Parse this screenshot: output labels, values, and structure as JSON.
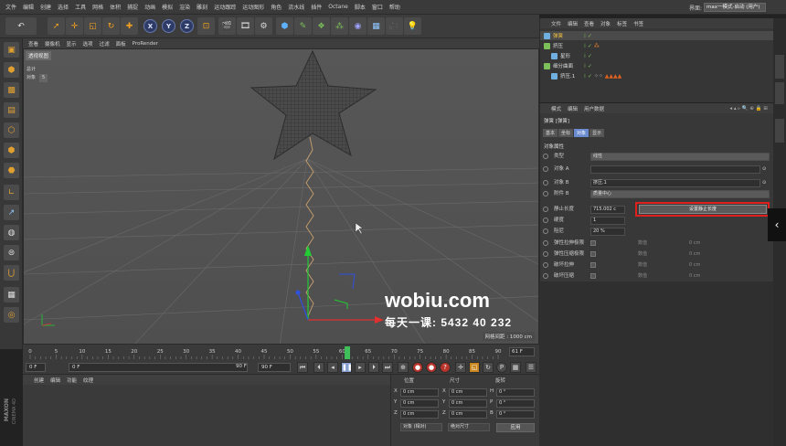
{
  "menubar": {
    "items": [
      "文件",
      "编辑",
      "创建",
      "选择",
      "工具",
      "网格",
      "体积",
      "捕捉",
      "动画",
      "模拟",
      "渲染",
      "雕刻",
      "运动跟踪",
      "运动图形",
      "角色",
      "流水线",
      "插件",
      "Octane",
      "脚本",
      "窗口",
      "帮助"
    ],
    "layout_label": "界面:",
    "layout_value": "max一模式-启动 (用户)"
  },
  "toolbar": {
    "axis_x": "X",
    "axis_y": "Y",
    "axis_z": "Z"
  },
  "viewport": {
    "menu": [
      "查看",
      "摄像机",
      "显示",
      "选项",
      "过滤",
      "面板",
      "ProRender"
    ],
    "view_label": "透视视图",
    "stats_total_label": "总计",
    "stats_objects_label": "对象",
    "stats_objects_value": "5",
    "grid_distance": "网格间距 : 1000 cm",
    "watermark_line1": "wobiu.com",
    "watermark_line2": "每天一课: 5432 40 232",
    "colors": {
      "background": "#545454",
      "grid": "#6a6a6a",
      "axis_y": "#22cc33",
      "axis_x": "#e03030",
      "axis_z": "#3050e0",
      "spring": "#c8a070"
    }
  },
  "timeline": {
    "ticks": [
      "0",
      "5",
      "10",
      "15",
      "20",
      "25",
      "30",
      "35",
      "40",
      "45",
      "50",
      "55",
      "60",
      "65",
      "70",
      "75",
      "80",
      "85",
      "90"
    ],
    "current_frame": "61",
    "end_field": "61 F"
  },
  "transport": {
    "start_field": "0 F",
    "start_field2": "0 F",
    "end_field": "90 F",
    "end_field2": "90 F"
  },
  "material": {
    "menu": [
      "创建",
      "编辑",
      "功能",
      "纹理"
    ]
  },
  "coords": {
    "head_position": "位置",
    "head_size": "尺寸",
    "head_rotation": "旋转",
    "rows": [
      {
        "axis": "X",
        "pos": "0 cm",
        "size_axis": "X",
        "size": "0 cm",
        "rot_axis": "H",
        "rot": "0 °"
      },
      {
        "axis": "Y",
        "pos": "0 cm",
        "size_axis": "Y",
        "size": "0 cm",
        "rot_axis": "P",
        "rot": "0 °"
      },
      {
        "axis": "Z",
        "pos": "0 cm",
        "size_axis": "Z",
        "size": "0 cm",
        "rot_axis": "B",
        "rot": "0 °"
      }
    ],
    "mode_select": "对象 (相对)",
    "size_select": "绝对尺寸",
    "apply": "应用"
  },
  "brand": {
    "line1": "MAXON",
    "line2": "CINEMA 4D"
  },
  "objects": {
    "menu": [
      "文件",
      "编辑",
      "查看",
      "对象",
      "标签",
      "书签"
    ],
    "items": [
      {
        "name": "弹簧",
        "color": "#6fb0e0"
      },
      {
        "name": "挤压",
        "color": "#7cc05a"
      },
      {
        "name": "星形",
        "color": "#6fb0e0"
      },
      {
        "name": "细分曲面",
        "color": "#7cc05a"
      },
      {
        "name": "挤压.1",
        "color": "#6fb0e0"
      }
    ]
  },
  "attributes": {
    "menu": [
      "模式",
      "编辑",
      "用户数据"
    ],
    "title": "弹簧 [弹簧]",
    "tabs": [
      "基本",
      "坐标",
      "对象",
      "显示"
    ],
    "active_tab": "对象",
    "section": "对象属性",
    "type_label": "类型",
    "type_value": "线性",
    "object_a_label": "对象 A",
    "object_a_value": "",
    "object_b_label": "对象 B",
    "object_b_value": "挤压.1",
    "attach_b_label": "附件 B",
    "attach_b_value": "质量中心",
    "rest_length_label": "静止长度",
    "rest_length_value": "715.002 c",
    "set_rest_button": "设置静止长度",
    "stiffness_label": "硬度",
    "stiffness_value": "1",
    "damping_label": "阻尼",
    "damping_value": "20 %",
    "flex_min_label": "弹性拉伸极限",
    "flex_max_label": "弹性压缩极限",
    "break_stretch_label": "破坏拉伸",
    "break_compress_label": "破坏压缩",
    "limit_label": "数值",
    "limit_value": "0 cm"
  }
}
